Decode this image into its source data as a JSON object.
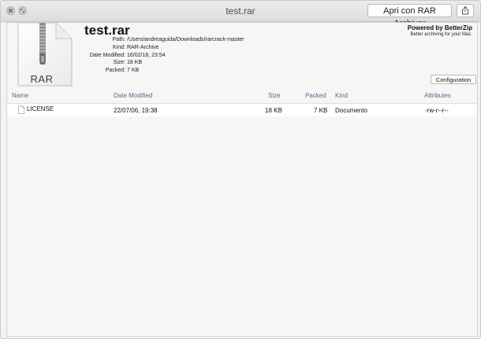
{
  "window": {
    "title": "test.rar",
    "open_button_label": "Apri con RAR Archiver"
  },
  "file": {
    "name": "test.rar",
    "icon_label": "RAR",
    "info": [
      {
        "label": "Path:",
        "value": "/Users/andreaguida/Downloads/rarcrack-master"
      },
      {
        "label": "Kind:",
        "value": "RAR-Archive"
      },
      {
        "label": "Date Modified:",
        "value": "16/02/18, 23:54"
      },
      {
        "label": "Size:",
        "value": "18 KB"
      },
      {
        "label": "Packed:",
        "value": "7 KB"
      }
    ]
  },
  "branding": {
    "powered_by": "Powered by BetterZip",
    "tagline": "Better archiving for your Mac."
  },
  "configuration_label": "Configuration",
  "table": {
    "columns": [
      "Name",
      "Date Modified",
      "Size",
      "Packed",
      "Kind",
      "Attributes"
    ],
    "rows": [
      {
        "name": "LICENSE",
        "date_modified": "22/07/06, 19:38",
        "size": "18 KB",
        "packed": "7 KB",
        "kind": "Documento",
        "attributes": "-rw-r--r--"
      }
    ]
  },
  "icons": {
    "close": "close-icon",
    "zoom": "fullscreen-icon",
    "share": "share-icon",
    "archive": "rar-archive-icon",
    "document": "document-icon"
  }
}
